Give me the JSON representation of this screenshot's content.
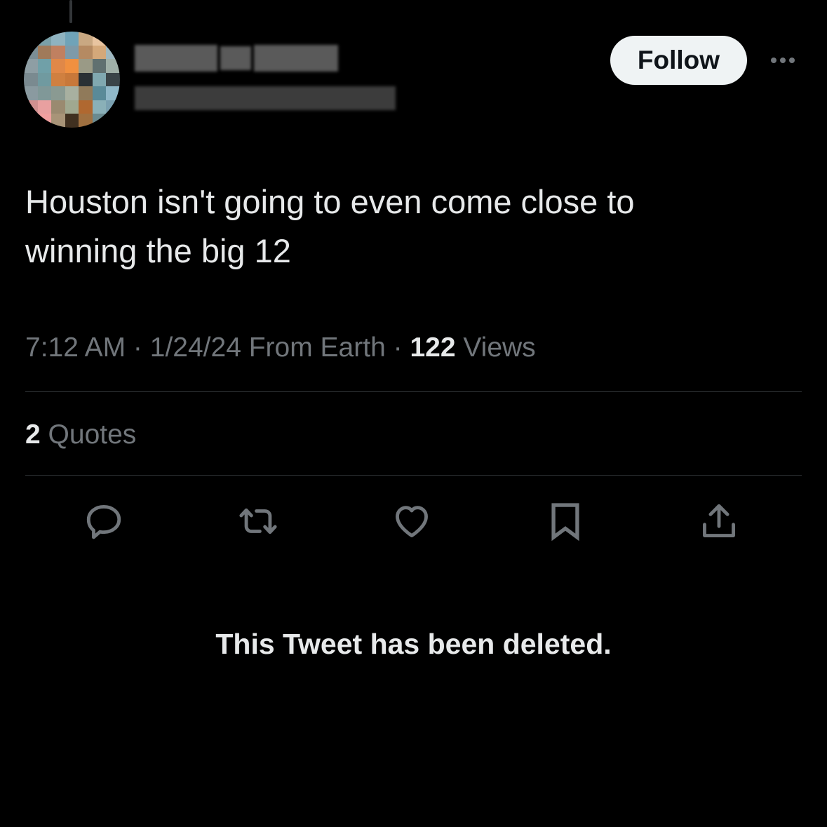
{
  "tweet": {
    "follow_label": "Follow",
    "text_line1": "Houston isn't going to even come close to",
    "text_line2": "winning the big 12",
    "time": "7:12 AM",
    "sep1": " · ",
    "date": "1/24/24",
    "source": " From Earth",
    "sep2": " · ",
    "views_count": "122",
    "views_label": " Views",
    "quotes_count": "2",
    "quotes_label": " Quotes"
  },
  "actions": {
    "reply": "reply-icon",
    "retweet": "retweet-icon",
    "like": "heart-icon",
    "bookmark": "bookmark-icon",
    "share": "share-icon"
  },
  "quoted_tweet": {
    "deleted_notice": "This Tweet has been deleted."
  },
  "colors": {
    "background": "#000000",
    "text_primary": "#e7e9ea",
    "text_secondary": "#71767b",
    "divider": "#2f3336",
    "follow_bg": "#eff3f4"
  }
}
